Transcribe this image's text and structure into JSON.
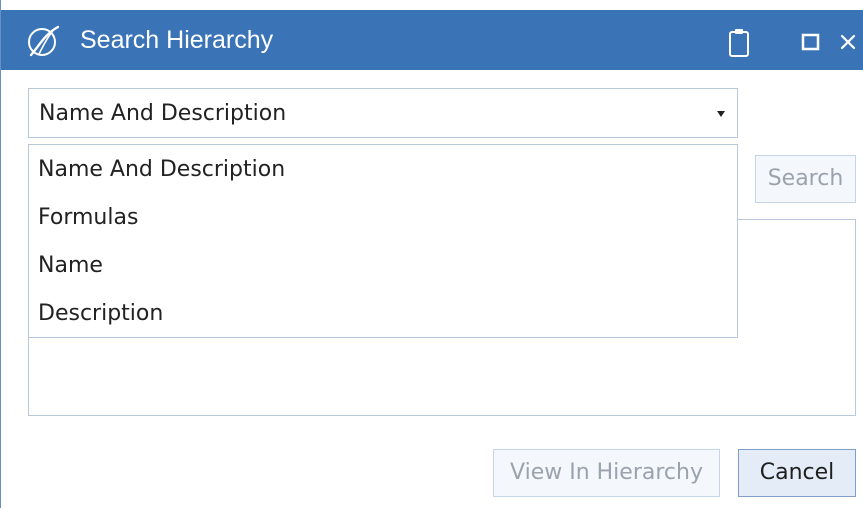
{
  "window": {
    "title": "Search Hierarchy",
    "title_bar_color": "#3a74b6",
    "icons": [
      "logo-icon",
      "clipboard-icon",
      "maximize-icon",
      "close-icon"
    ]
  },
  "search_field": {
    "selected": "Name And Description",
    "options": [
      "Name And Description",
      "Formulas",
      "Name",
      "Description"
    ]
  },
  "buttons": {
    "search": "Search",
    "view_in_hierarchy": "View In Hierarchy",
    "cancel": "Cancel"
  }
}
